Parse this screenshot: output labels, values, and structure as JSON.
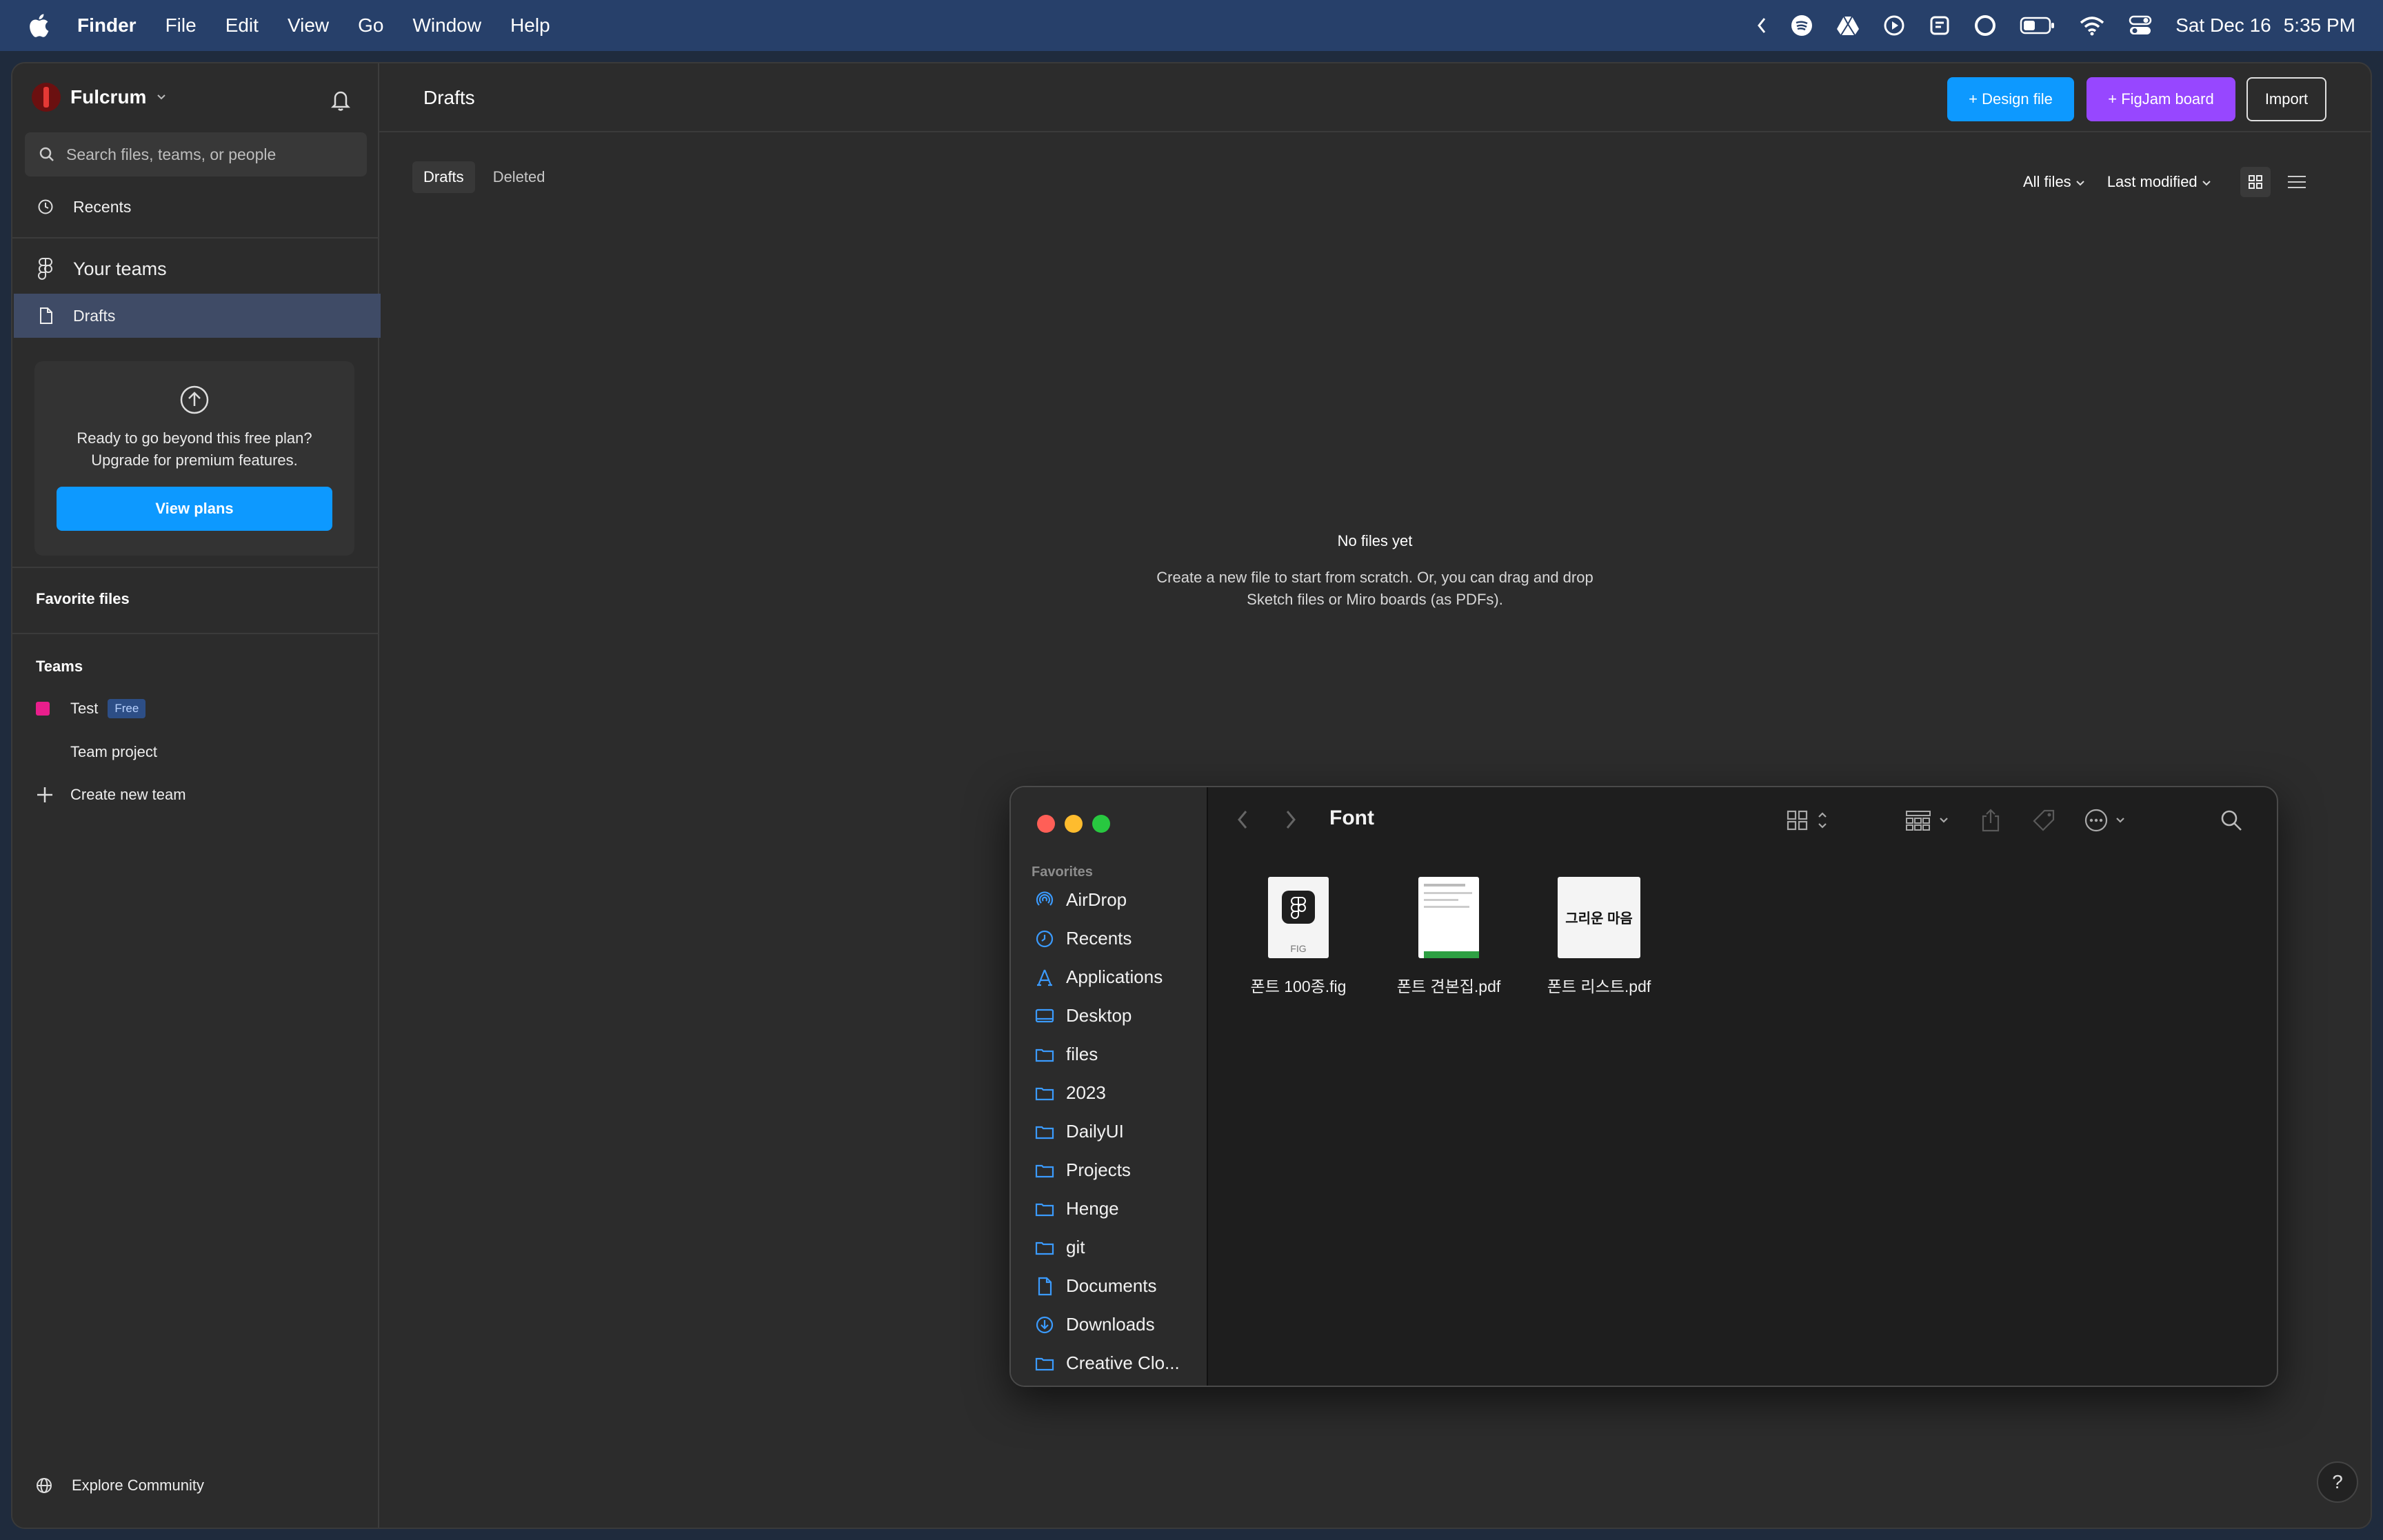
{
  "menubar": {
    "app": "Finder",
    "menus": [
      "File",
      "Edit",
      "View",
      "Go",
      "Window",
      "Help"
    ],
    "date": "Sat Dec 16",
    "time": "5:35 PM"
  },
  "sidebar": {
    "workspace": "Fulcrum",
    "search_placeholder": "Search files, teams, or people",
    "recents": "Recents",
    "your_teams": "Your teams",
    "drafts": "Drafts",
    "upgrade_line1": "Ready to go beyond this free plan?",
    "upgrade_line2": "Upgrade for premium features.",
    "view_plans": "View plans",
    "favorite_files": "Favorite files",
    "teams": "Teams",
    "team_name": "Test",
    "team_badge": "Free",
    "team_project": "Team project",
    "create_team": "Create new team",
    "explore": "Explore Community"
  },
  "main": {
    "title": "Drafts",
    "btn_design": "+ Design file",
    "btn_figjam": "+ FigJam board",
    "btn_import": "Import",
    "tabs": [
      "Drafts",
      "Deleted"
    ],
    "filter_files": "All files",
    "filter_sort": "Last modified",
    "empty_title": "No files yet",
    "empty_line1": "Create a new file to start from scratch. Or, you can drag and drop",
    "empty_line2": "Sketch files or Miro boards (as PDFs).",
    "help": "?"
  },
  "finder": {
    "title": "Font",
    "favorites_label": "Favorites",
    "sidebar_items": [
      "AirDrop",
      "Recents",
      "Applications",
      "Desktop",
      "files",
      "2023",
      "DailyUI",
      "Projects",
      "Henge",
      "git",
      "Documents",
      "Downloads",
      "Creative Clo..."
    ],
    "files": [
      {
        "name": "폰트 100종.fig",
        "thumb_label": "FIG"
      },
      {
        "name": "폰트 견본집.pdf"
      },
      {
        "name": "폰트 리스트.pdf",
        "thumb_label": "그리운 마음"
      }
    ]
  },
  "colors": {
    "accent_blue": "#0d99ff",
    "figjam_purple": "#9747ff",
    "team_pink": "#e91e8c",
    "close": "#ff5f57",
    "minimize": "#febc2e",
    "zoom": "#28c840"
  }
}
